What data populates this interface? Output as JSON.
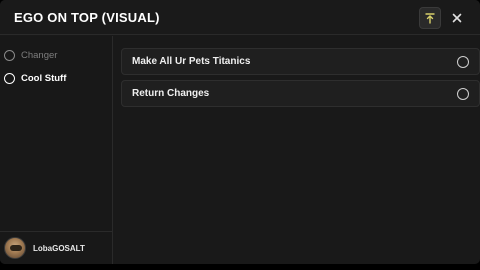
{
  "window": {
    "title": "EGO ON TOP (VISUAL)"
  },
  "titlebar_buttons": {
    "minimize_icon": "minimize-icon",
    "close_icon": "close-icon",
    "close_glyph": "✕"
  },
  "sidebar": {
    "items": [
      {
        "label": "Changer",
        "icon": "ring-icon",
        "active": false
      },
      {
        "label": "Cool Stuff",
        "icon": "ring-icon",
        "active": true
      }
    ]
  },
  "user": {
    "name": "LobaGOSALT",
    "avatar_icon": "avatar"
  },
  "content": {
    "buttons": [
      {
        "label": "Make All Ur Pets Titanics",
        "icon": "tap-icon"
      },
      {
        "label": "Return Changes",
        "icon": "tap-icon"
      }
    ]
  },
  "colors": {
    "background": "#191919",
    "text": "#f0f0f0",
    "muted": "#7d7d7d",
    "accent_minimize": "#d8d06a"
  }
}
